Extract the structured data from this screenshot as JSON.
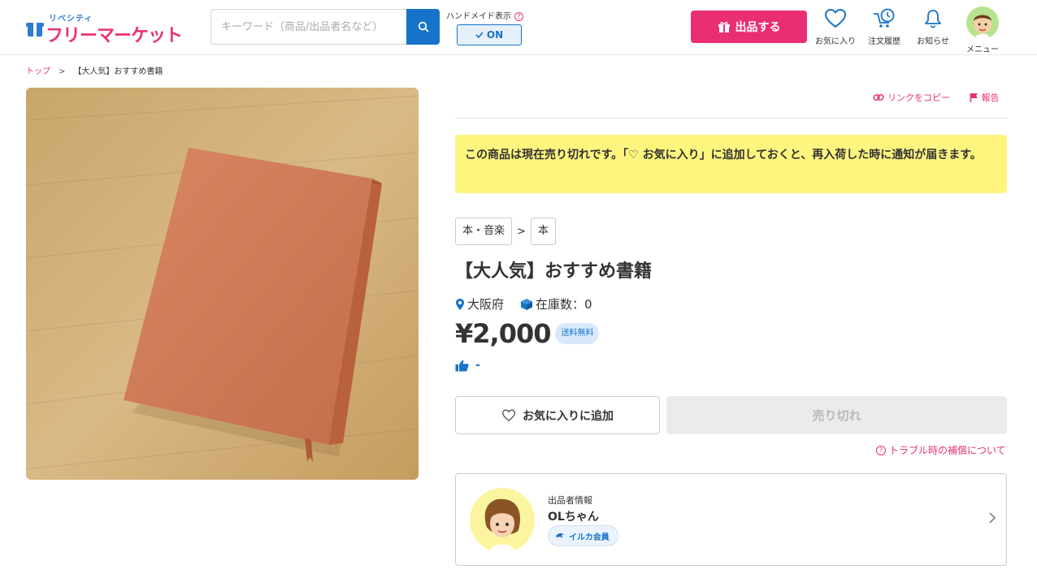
{
  "header": {
    "logo_small": "リベシティ",
    "logo_main": "フリーマーケット",
    "search_placeholder": "キーワード（商品/出品者名など）",
    "handmade_label": "ハンドメイド表示",
    "handmade_toggle": "ON",
    "sell_button": "出品する",
    "nav": {
      "favorites": "お気に入り",
      "orders": "注文履歴",
      "notifications": "お知らせ",
      "menu": "メニュー"
    }
  },
  "breadcrumb": {
    "top": "トップ",
    "separator": ">",
    "current": "【大人気】おすすめ書籍"
  },
  "product": {
    "copy_link": "リンクをコピー",
    "report": "報告",
    "soldout_notice": "この商品は現在売り切れです。「♡ お気に入り」に追加しておくと、再入荷した時に通知が届きます。",
    "categories": [
      "本・音楽",
      "本"
    ],
    "category_separator": ">",
    "title": "【大人気】おすすめ書籍",
    "location": "大阪府",
    "stock": "在庫数：0",
    "price": "¥2,000",
    "shipping": "送料無料",
    "likes": "-",
    "favorite_button": "お気に入りに追加",
    "soldout_button": "売り切れ",
    "trouble_link": "トラブル時の補償について"
  },
  "seller": {
    "label": "出品者情報",
    "name": "OLちゃん",
    "badge": "イルカ会員"
  },
  "colors": {
    "brand_pink": "#ea2e74",
    "brand_blue": "#1773c9",
    "notice_yellow": "#fdf57e"
  }
}
